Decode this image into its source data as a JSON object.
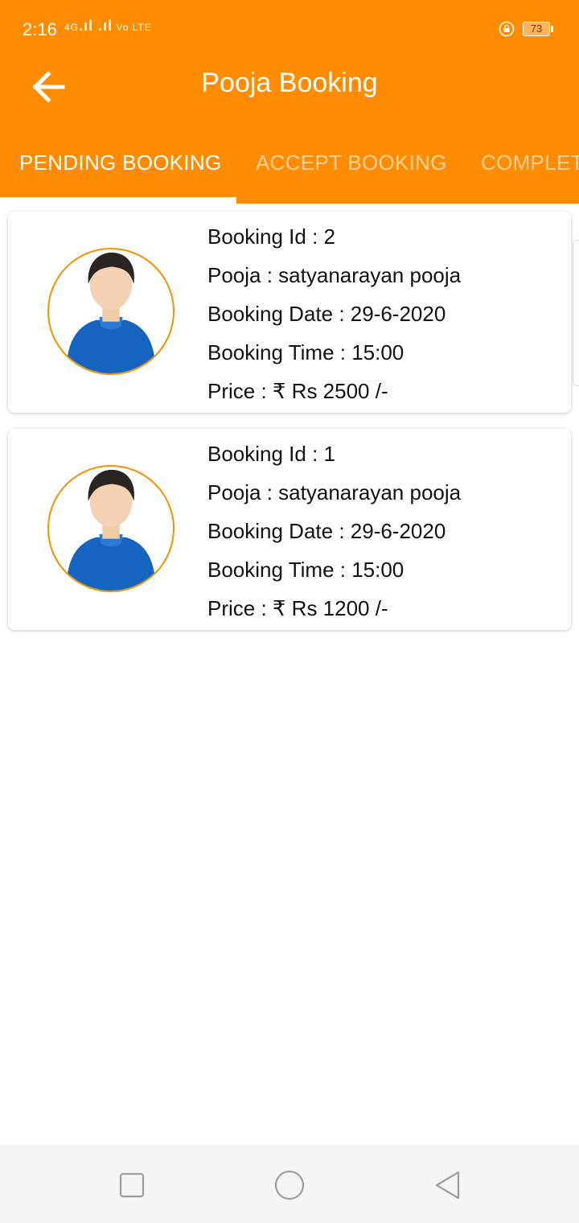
{
  "status_bar": {
    "time": "2:16",
    "network": "4G",
    "volte": "Vo LTE",
    "battery": "73"
  },
  "toolbar": {
    "title": "Pooja Booking"
  },
  "tabs": [
    {
      "label": "PENDING BOOKING",
      "active": true
    },
    {
      "label": "ACCEPT BOOKING",
      "active": false
    },
    {
      "label": "COMPLET",
      "active": false
    }
  ],
  "bookings": [
    {
      "id_line": "Booking Id : 2",
      "pooja_line": "Pooja :  satyanarayan pooja",
      "date_line": "Booking Date : 29-6-2020",
      "time_line": "Booking Time : 15:00",
      "price_line": "Price : ₹ Rs 2500 /-"
    },
    {
      "id_line": "Booking Id : 1",
      "pooja_line": "Pooja :  satyanarayan pooja",
      "date_line": "Booking Date : 29-6-2020",
      "time_line": "Booking Time : 15:00",
      "price_line": "Price : ₹ Rs 1200 /-"
    }
  ],
  "colors": {
    "primary": "#FF8C00",
    "avatar_ring": "#F39200",
    "nav_background": "#f5f5f5"
  },
  "icons": {
    "back": "arrow-left-icon",
    "lock": "lock-rotation-icon",
    "nav_recent": "square-icon",
    "nav_home": "circle-icon",
    "nav_back": "triangle-back-icon"
  }
}
